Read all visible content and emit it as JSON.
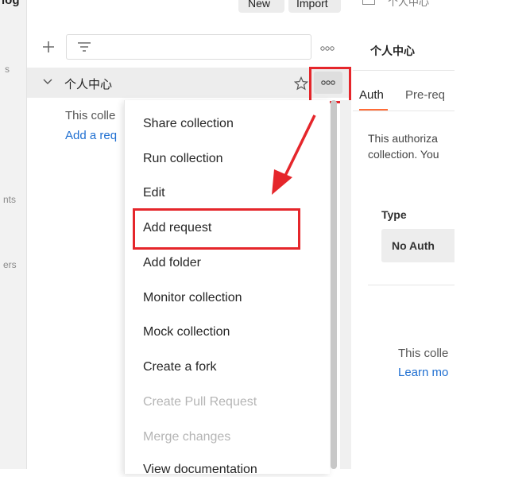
{
  "top": {
    "left_fragment": "log",
    "new_label": "New",
    "import_label": "Import",
    "right_fragment": "个人中心"
  },
  "left_nav": {
    "item1": "s",
    "item2": "nts",
    "item3": "ers"
  },
  "collections": {
    "collection_name": "个人中心",
    "empty_text": "This colle",
    "add_request_link": "Add a req"
  },
  "context_menu": {
    "items": [
      {
        "label": "Share collection",
        "disabled": false
      },
      {
        "label": "Run collection",
        "disabled": false
      },
      {
        "label": "Edit",
        "disabled": false
      },
      {
        "label": "Add request",
        "disabled": false
      },
      {
        "label": "Add folder",
        "disabled": false
      },
      {
        "label": "Monitor collection",
        "disabled": false
      },
      {
        "label": "Mock collection",
        "disabled": false
      },
      {
        "label": "Create a fork",
        "disabled": false
      },
      {
        "label": "Create Pull Request",
        "disabled": true
      },
      {
        "label": "Merge changes",
        "disabled": true
      },
      {
        "label": "View documentation",
        "disabled": false
      }
    ]
  },
  "right_panel": {
    "title": "个人中心",
    "tabs": [
      "Auth",
      "Pre-req"
    ],
    "auth_text_line1": "This authoriza",
    "auth_text_line2": "collection. You",
    "type_label": "Type",
    "type_value": "No Auth",
    "empty_text": "This colle",
    "learn_more": "Learn mo"
  },
  "colors": {
    "accent": "#ff6c37",
    "link": "#1f6fd1",
    "highlight": "#e5262b"
  }
}
